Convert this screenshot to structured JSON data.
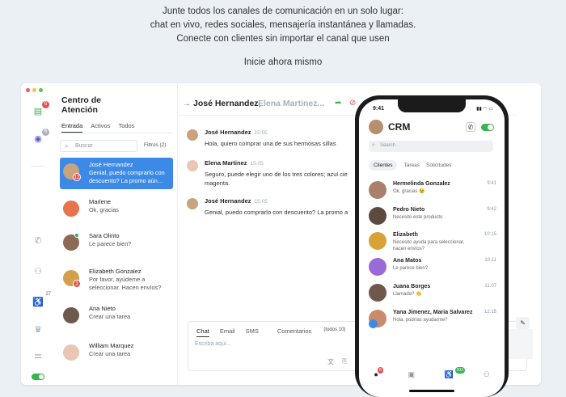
{
  "hero": {
    "line1": "Junte todos los canales de comunicación en un solo lugar:",
    "line2": "chat en vivo, redes sociales, mensajería instantánea y llamadas.",
    "line3": "Conecte con clientes sin importar el canal que usen",
    "cta": "Inicie ahora mismo"
  },
  "rail": {
    "badge_chat": "6",
    "badge_messenger": "6",
    "superscript": "27"
  },
  "list": {
    "title": "Centro de Atención",
    "tabs": [
      "Entrada",
      "Activos",
      "Todos"
    ],
    "search_placeholder": "Buscar",
    "filters": "Filtros (2)",
    "items": [
      {
        "name": "José Hernandez",
        "preview": "Genial, puedo comprarlo con descuento? La promo aún...",
        "badge": "12"
      },
      {
        "name": "Marlene",
        "preview": "Ok, gracias",
        "badge": ""
      },
      {
        "name": "Sara Olinto",
        "preview": "Le parece bien?",
        "badge": ""
      },
      {
        "name": "Elizabeth Gonzalez",
        "preview": "Por favor, ayúdeme a seleccionar. Hacen envíos?",
        "badge": "2"
      },
      {
        "name": "Ana Nieto",
        "preview": "Crear una tarea",
        "badge": ""
      },
      {
        "name": "William Marquez",
        "preview": "Crear una tarea",
        "badge": ""
      }
    ]
  },
  "chat": {
    "header_name": "José Hernandez,",
    "header_others": "Elena Martinez...",
    "messages": [
      {
        "who": "José Hernandez",
        "time": "15:05",
        "text": "Hola, quiero comprar una de sus hermosas sillas"
      },
      {
        "who": "Elena Martinez",
        "time": "15:05",
        "text": "Seguro, puede elegir uno de los tres colores; azul cie magenta."
      },
      {
        "who": "José Hernandez",
        "time": "15:05",
        "text": "Genial, puedo comprarlo con descuento? La promo a"
      }
    ],
    "composer": {
      "tabs": [
        "Chat",
        "Email",
        "SMS",
        "Comentarios"
      ],
      "todos": "(todos 10)",
      "placeholder": "Escriba aquí..."
    }
  },
  "phone": {
    "time": "9:41",
    "title": "CRM",
    "search_placeholder": "Search",
    "tabs": [
      "Clientes",
      "Tareas",
      "Solicitudes"
    ],
    "rows": [
      {
        "name": "Hermelinda Gonzalez",
        "preview": "Ok, gracias 😉",
        "time": "9:41"
      },
      {
        "name": "Pedro Nieto",
        "preview": "Necesito este producto",
        "time": "9:42"
      },
      {
        "name": "Elizabeth",
        "preview": "Necesito ayuda para seleccionar, hacen envíos?",
        "time": "10:15"
      },
      {
        "name": "Ana Matos",
        "preview": "Le parece bien?",
        "time": "10:11"
      },
      {
        "name": "Juana Borges",
        "preview": "Llamada? 👏",
        "time": "11:07"
      },
      {
        "name": "Yana Jimenez, Maria Salvarez",
        "preview": "Hola, podrías ayudarme?",
        "time": "12:15"
      }
    ],
    "nav_badge_chat": "8",
    "nav_badge_green": "203"
  },
  "colors": {
    "accent": "#3d8ae6",
    "green": "#36b44f",
    "red": "#e05353"
  }
}
